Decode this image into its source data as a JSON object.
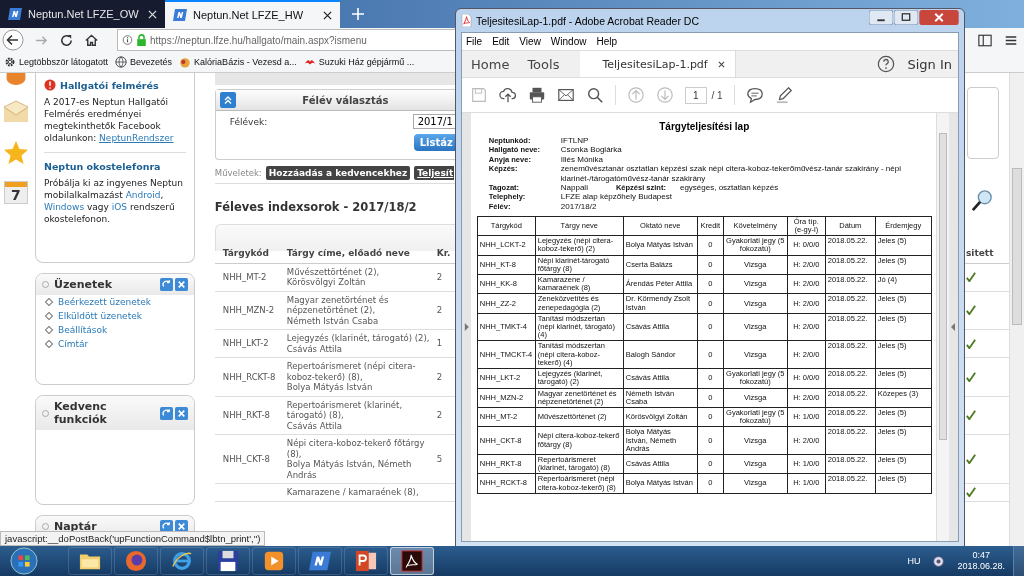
{
  "browser": {
    "tabs": [
      {
        "label": "Neptun.Net LFZE_OW",
        "selected": false
      },
      {
        "label": "Neptun.Net LFZE_HW",
        "selected": true
      }
    ],
    "url": "https://neptun.lfze.hu/hallgato/main.aspx?ismenu",
    "bookmarks": [
      "Legtöbbször látogatott",
      "Bevezetés",
      "KalóriaBázis - Vezesd a...",
      "Suzuki Ház gépjármű ..."
    ],
    "status_text": "javascript:__doPostBack('upFunctionCommand$lbtn_print','')"
  },
  "sidebar": {
    "calendar_day": "7",
    "survey": {
      "title": "Hallgatói felmérés",
      "text": [
        {
          "kind": "text",
          "text": "A 2017-es Neptun Hallgatói Felmérés eredményei megtekinthetők Facebook oldalunkon: "
        },
        {
          "kind": "link",
          "text": "NeptunRendszer"
        }
      ]
    },
    "mobile": {
      "title": "Neptun okostelefonra",
      "text": [
        {
          "kind": "text",
          "text": "Próbálja ki az ingyenes Neptun mobilalkalmazást "
        },
        {
          "kind": "link",
          "text": "Android"
        },
        {
          "kind": "text",
          "text": ", "
        },
        {
          "kind": "link",
          "text": "Windows"
        },
        {
          "kind": "text",
          "text": " vagy "
        },
        {
          "kind": "link",
          "text": "iOS"
        },
        {
          "kind": "text",
          "text": " rendszerű okostelefonon."
        }
      ]
    },
    "panels": [
      {
        "title": "Üzenetek",
        "links": [
          "Beérkezett üzenetek",
          "Elküldött üzenetek",
          "Beállítások",
          "Címtár"
        ]
      },
      {
        "title": "Kedvenc funkciók"
      },
      {
        "title": "Naptár"
      }
    ]
  },
  "semester_panel": {
    "title": "Félév választás",
    "label": "Félévek:",
    "value": "2017/1",
    "button": "Listáz"
  },
  "actions": {
    "label": "Műveletek:",
    "buttons": [
      "Hozzáadás a kedvencekhez",
      "Teljesít"
    ]
  },
  "index": {
    "heading": "Féleves indexsorok - 2017/18/2",
    "columns": [
      "Tárgykód",
      "Tárgy címe, előadó neve",
      "Kr.",
      "sitett"
    ],
    "rows": [
      {
        "code": "NHH_MT-2",
        "title": "Művészettörténet (2),",
        "teacher": "Körösvölgyi Zoltán",
        "credits": "2",
        "completed": true
      },
      {
        "code": "NHH_MZN-2",
        "title": "Magyar zenetörténet és népzenetörténet (2),",
        "teacher": "Németh István Csaba",
        "credits": "2",
        "completed": true
      },
      {
        "code": "NHH_LKT-2",
        "title": "Lejegyzés (klarinét, tárogató) (2),",
        "teacher": "Csávás Attila",
        "credits": "1",
        "completed": true
      },
      {
        "code": "NHH_RCKT-8",
        "title": "Repertoárismeret (népi citera-koboz-tekerő) (8),",
        "teacher": "Bolya Mátyás István",
        "credits": "2",
        "completed": true
      },
      {
        "code": "NHH_RKT-8",
        "title": "Repertoárismeret (klarinét, tárogató) (8),",
        "teacher": "Csávás Attila",
        "credits": "2",
        "completed": true
      },
      {
        "code": "NHH_CKT-8",
        "title": "Népi citera-koboz-tekerő főtárgy (8),",
        "teacher": "Bolya Mátyás István, Németh András",
        "credits": "5",
        "completed": true
      },
      {
        "title": "Kamarazene / kamaraének (8),",
        "completed": true
      }
    ]
  },
  "acrobat": {
    "title": "TeljesitesiLap-1.pdf - Adobe Acrobat Reader DC",
    "menu": [
      "File",
      "Edit",
      "View",
      "Window",
      "Help"
    ],
    "nav": [
      "Home",
      "Tools"
    ],
    "doc_tab": "TeljesitesiLap-1.pdf",
    "sign_in": "Sign In",
    "page": "1",
    "page_total": "/ 1",
    "save_disabled": true,
    "page_nav_disabled": true,
    "document": {
      "title": "Tárgyteljesítési lap",
      "fields": [
        {
          "label": "Neptunkód:",
          "value": "IFTLNP"
        },
        {
          "label": "Hallgató neve:",
          "value": "Csonka Boglárka"
        },
        {
          "label": "Anyja neve:",
          "value": "Illés Mónika"
        },
        {
          "label": "Képzés:",
          "value": "zeneművésztanár osztatlan képzési szak népi citera-koboz-tekerőművész-tanár szakirány - népi klarinét-/tárogatóművész-tanár szakirány"
        },
        {
          "label": "Tagozat:",
          "value": "Nappali",
          "label_2": "Képzési szint:",
          "value_2": "egységes, osztatlan képzés"
        },
        {
          "label": "Telephely:",
          "value": "LFZE alap képzőhely Budapest"
        },
        {
          "label": "Félév:",
          "value": "2017/18/2"
        }
      ],
      "columns": [
        "Tárgykód",
        "Tárgy neve",
        "Oktató neve",
        "Kredit",
        "Követelmény",
        "Óra típ. (e-gy-l)",
        "Dátum",
        "Érdemjegy"
      ],
      "rows": [
        [
          "NHH_LCKT-2",
          "Lejegyzés (népi citera-koboz-tekerő) (2)",
          "Bolya Mátyás István",
          "0",
          "Gyakorlati jegy (5 fokozatú)",
          "H: 0/0/0",
          "2018.05.22.",
          "Jeles (5)"
        ],
        [
          "NHH_KT-8",
          "Népi klarinét-tárogató főtárgy (8)",
          "Cserta Balázs",
          "0",
          "Vizsga",
          "H: 2/0/0",
          "2018.05.22.",
          "Jeles (5)"
        ],
        [
          "NHH_KK-8",
          "Kamarazene / kamaraének (8)",
          "Árendás Péter Attila",
          "0",
          "Vizsga",
          "H: 2/0/0",
          "2018.05.22.",
          "Jó (4)"
        ],
        [
          "NHH_ZZ-2",
          "Zeneközvetítés és zenepedagógia (2)",
          "Dr. Körmendy Zsolt István",
          "0",
          "Vizsga",
          "H: 2/0/0",
          "2018.05.22.",
          "Jeles (5)"
        ],
        [
          "NHH_TMKT-4",
          "Tanítási módszertan (népi klarinét, tárogató) (4)",
          "Csávás Attila",
          "0",
          "Vizsga",
          "H: 2/0/0",
          "2018.05.22.",
          "Jeles (5)"
        ],
        [
          "NHH_TMCKT-4",
          "Tanítási módszertan (népi citera-koboz-tekerő) (4)",
          "Balogh Sándor",
          "0",
          "Vizsga",
          "H: 2/0/0",
          "2018.05.22.",
          "Jeles (5)"
        ],
        [
          "NHH_LKT-2",
          "Lejegyzés (klarinét, tárogató) (2)",
          "Csávás Attila",
          "0",
          "Gyakorlati jegy (5 fokozatú)",
          "H: 0/0/0",
          "2018.05.22.",
          "Jeles (5)"
        ],
        [
          "NHH_MZN-2",
          "Magyar zenetörténet és népzenetörténet (2)",
          "Németh István Csaba",
          "0",
          "Vizsga",
          "H: 2/0/0",
          "2018.05.22.",
          "Közepes (3)"
        ],
        [
          "NHH_MT-2",
          "Művészettörténet (2)",
          "Körösvölgyi Zoltán",
          "0",
          "Gyakorlati jegy (5 fokozatú)",
          "H: 1/0/0",
          "2018.05.22.",
          "Jeles (5)"
        ],
        [
          "NHH_CKT-8",
          "Népi citera-koboz-tekerő főtárgy (8)",
          "Bolya Mátyás István, Németh András",
          "0",
          "Vizsga",
          "H: 2/0/0",
          "2018.05.22.",
          "Jeles (5)"
        ],
        [
          "NHH_RKT-8",
          "Repertoárismeret (klarinét, tárogató) (8)",
          "Csávás Attila",
          "0",
          "Vizsga",
          "H: 1/0/0",
          "2018.05.22.",
          "Jeles (5)"
        ],
        [
          "NHH_RCKT-8",
          "Repertoárismeret (népi citera-koboz-tekerő) (8)",
          "Bolya Mátyás István",
          "0",
          "Vizsga",
          "H: 1/0/0",
          "2018.05.22.",
          "Jeles (5)"
        ]
      ]
    }
  },
  "taskbar": {
    "apps": [
      {
        "kind": "folder",
        "selected": false
      },
      {
        "kind": "firefox",
        "selected": false
      },
      {
        "kind": "ie",
        "selected": false
      },
      {
        "kind": "floppy",
        "selected": false
      },
      {
        "kind": "media",
        "selected": false
      },
      {
        "kind": "neptun",
        "selected": false
      },
      {
        "kind": "powerpoint",
        "selected": false
      },
      {
        "kind": "acrobat",
        "selected": true
      }
    ],
    "language": "HU",
    "time": "0:47",
    "date": "2018.06.28."
  }
}
